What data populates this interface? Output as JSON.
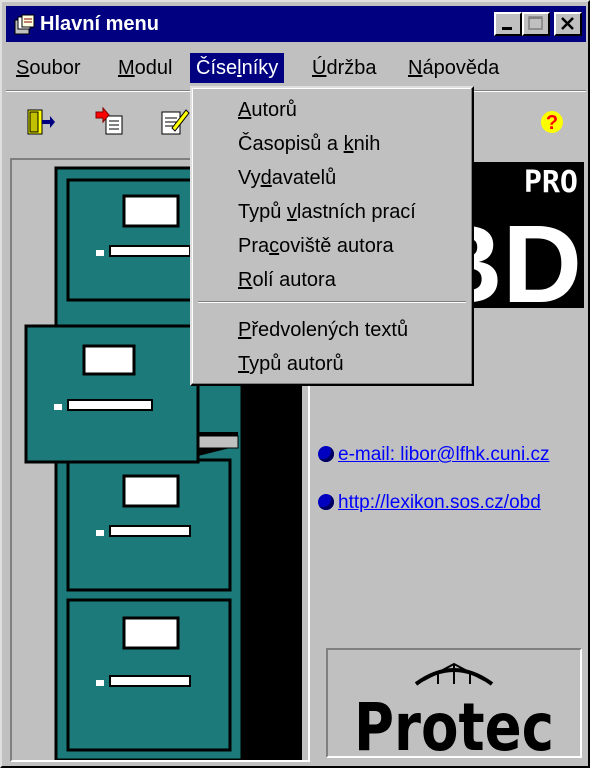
{
  "window": {
    "title": "Hlavní menu",
    "controls": [
      "minimize",
      "maximize",
      "close"
    ]
  },
  "menubar": {
    "items": [
      {
        "pre": "",
        "u": "S",
        "post": "oubor"
      },
      {
        "pre": "",
        "u": "M",
        "post": "odul"
      },
      {
        "pre": "Číse",
        "u": "l",
        "post": "níky"
      },
      {
        "pre": "",
        "u": "Ú",
        "post": "držba"
      },
      {
        "pre": "",
        "u": "N",
        "post": "ápověda"
      }
    ],
    "active_index": 2
  },
  "toolbar": {
    "icons": [
      "exit-door-icon",
      "import-document-icon",
      "edit-notepad-icon",
      "help-icon"
    ]
  },
  "dropdown": {
    "items": [
      {
        "pre": "",
        "u": "A",
        "post": "utorů"
      },
      {
        "pre": "Časopisů a ",
        "u": "k",
        "post": "nih"
      },
      {
        "pre": "Vy",
        "u": "d",
        "post": "avatelů"
      },
      {
        "pre": "Typů ",
        "u": "v",
        "post": "lastních prací"
      },
      {
        "pre": "Pra",
        "u": "c",
        "post": "oviště autora"
      },
      {
        "pre": "",
        "u": "R",
        "post": "olí autora"
      },
      {
        "pre": "",
        "u": "P",
        "post": "ředvolených textů"
      },
      {
        "pre": "",
        "u": "T",
        "post": "ypů autorů"
      }
    ]
  },
  "links": {
    "email": "e-mail: libor@lfhk.cuni.cz",
    "web": "http://lexikon.sos.cz/obd"
  },
  "logos": {
    "pro_text": "PRO",
    "obd_text": "BD",
    "protec_text": "Protec"
  },
  "colors": {
    "titlebar": "#000080",
    "cabinet": "#1c7a7a",
    "link": "#0000ff"
  }
}
